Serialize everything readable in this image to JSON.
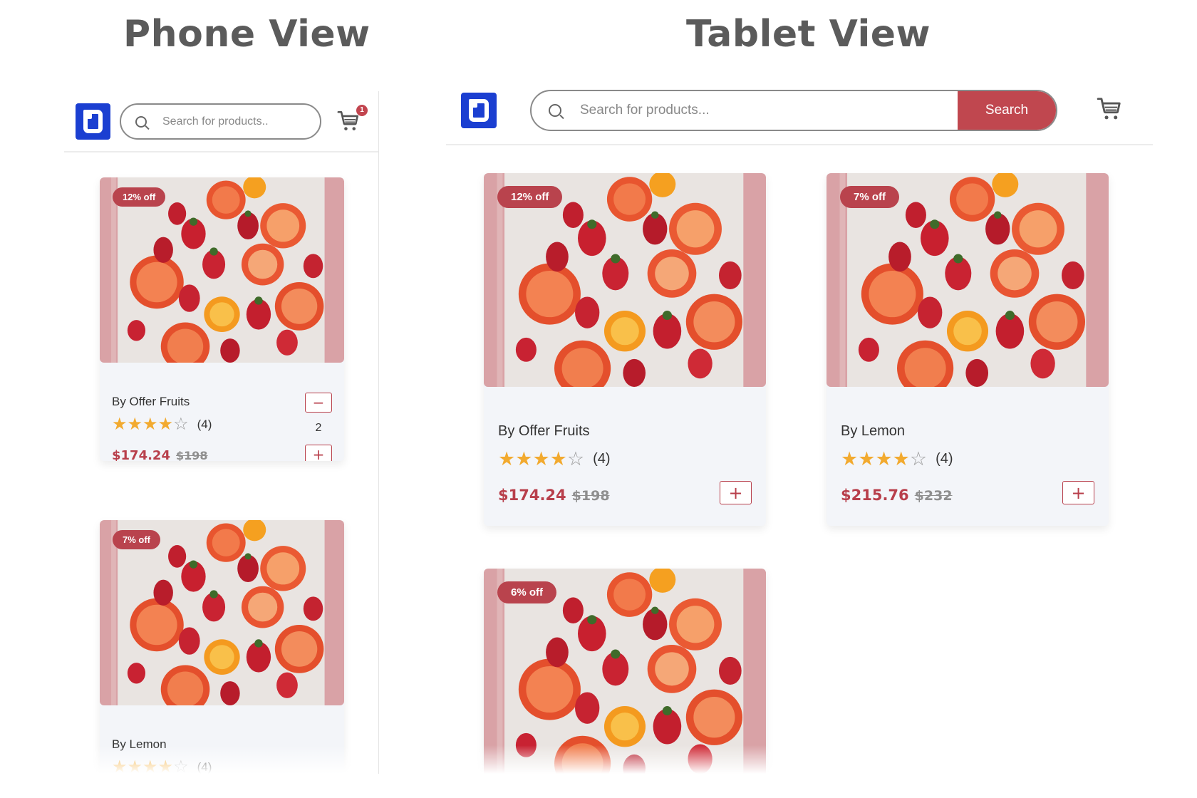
{
  "titles": {
    "phone": "Phone View",
    "tablet": "Tablet View"
  },
  "phone": {
    "search_placeholder": "Search for products..",
    "cart_count": "1",
    "products": [
      {
        "discount": "12% off",
        "brand": "By Offer Fruits",
        "rating": 4,
        "rating_count": "(4)",
        "price": "$174.24",
        "old_price": "$198",
        "quantity": "2",
        "minus": "−",
        "plus": "+"
      },
      {
        "discount": "7% off",
        "brand": "By Lemon",
        "rating": 4,
        "rating_count": "(4)"
      }
    ]
  },
  "tablet": {
    "search_placeholder": "Search for products...",
    "search_button": "Search",
    "products": [
      {
        "discount": "12% off",
        "brand": "By Offer Fruits",
        "rating": 4,
        "rating_count": "(4)",
        "price": "$174.24",
        "old_price": "$198",
        "plus": "+"
      },
      {
        "discount": "7% off",
        "brand": "By Lemon",
        "rating": 4,
        "rating_count": "(4)",
        "price": "$215.76",
        "old_price": "$232",
        "plus": "+"
      },
      {
        "discount": "6% off"
      }
    ]
  },
  "icons": {
    "logo": "brand-logo",
    "search": "search-icon",
    "cart": "cart-icon",
    "star": "star-icon"
  },
  "colors": {
    "accent": "#c0474f",
    "logo": "#1b3fd1",
    "star": "#f2aa2f",
    "card_bg": "#f3f5f9"
  }
}
